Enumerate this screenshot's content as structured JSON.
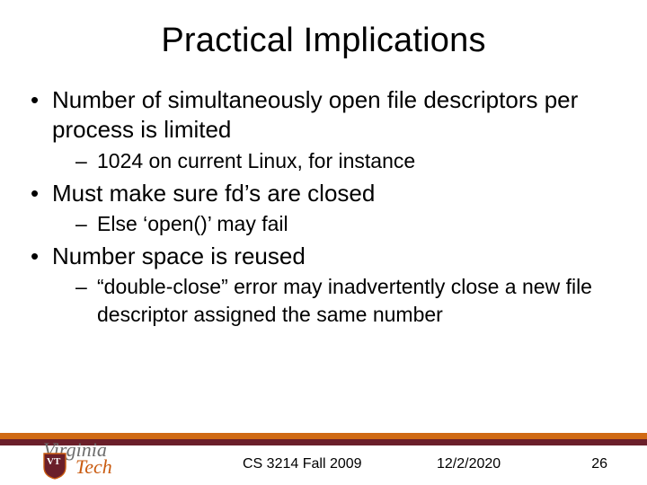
{
  "title": "Practical Implications",
  "bullets": {
    "b1": "Number of simultaneously open file descriptors per process is limited",
    "b1_sub1": "1024 on current Linux, for instance",
    "b2": "Must make sure fd’s are closed",
    "b2_sub1": "Else ‘open()’ may fail",
    "b3": "Number space is reused",
    "b3_sub1": "“double-close” error may inadvertently close a new file descriptor assigned the same number"
  },
  "logo": {
    "line1": "Virginia",
    "line2": "Tech",
    "vt": "VT"
  },
  "footer": {
    "course": "CS 3214 Fall 2009",
    "date": "12/2/2020",
    "page": "26"
  },
  "colors": {
    "orange": "#d06a14",
    "maroon": "#6b1f2a"
  }
}
